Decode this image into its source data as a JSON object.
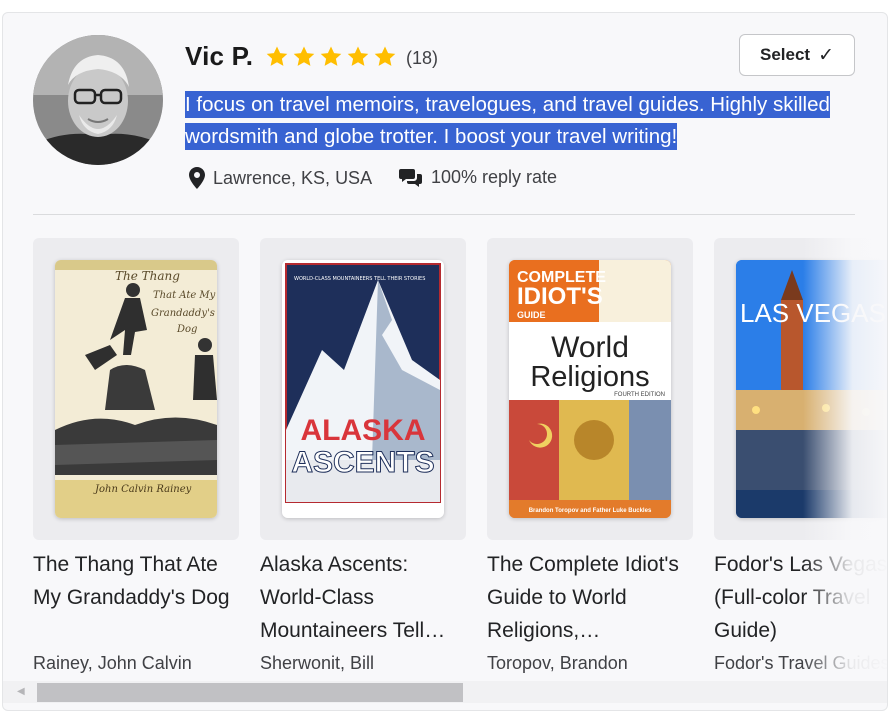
{
  "profile": {
    "name": "Vic P.",
    "rating_stars": 5,
    "rating_count": "(18)",
    "bio": "I focus on travel memoirs, travelogues, and travel guides. Highly skilled wordsmith and globe trotter. I boost your travel writing!",
    "location": "Lawrence, KS, USA",
    "reply_rate": "100% reply rate",
    "select_label": "Select",
    "select_icon": "checkmark-icon"
  },
  "books": [
    {
      "title": "The Thang That Ate My Grandaddy's Dog",
      "author": "Rainey, John Calvin",
      "cover": {
        "lines": [
          "The Thang",
          "That Ate My",
          "Grandaddy's",
          "Dog"
        ],
        "byline": "John Calvin Rainey"
      }
    },
    {
      "title": "Alaska Ascents: World-Class Mountaineers Tell…",
      "author": "Sherwonit, Bill",
      "cover": {
        "top": "WORLD-CLASS MOUNTAINEERS TELL THEIR STORIES",
        "line1": "ALASKA",
        "line2": "ASCENTS"
      }
    },
    {
      "title": "The Complete Idiot's Guide to World Religions,…",
      "author": "Toropov, Brandon",
      "cover": {
        "brand1": "COMPLETE",
        "brand2": "IDIOT'S",
        "brand3": "GUIDE",
        "line1": "World",
        "line2": "Religions",
        "edition": "FOURTH EDITION",
        "authors": "Brandon Toropov and Father Luke Buckles"
      }
    },
    {
      "title": "Fodor's Las Vegas (Full-color Travel Guide)",
      "author": "Fodor's Travel Guides",
      "cover": {
        "line1": "LAS VEGAS"
      }
    }
  ],
  "colors": {
    "highlight": "#3863d2",
    "star": "#ffbe00",
    "alaska_red": "#d9353b"
  }
}
